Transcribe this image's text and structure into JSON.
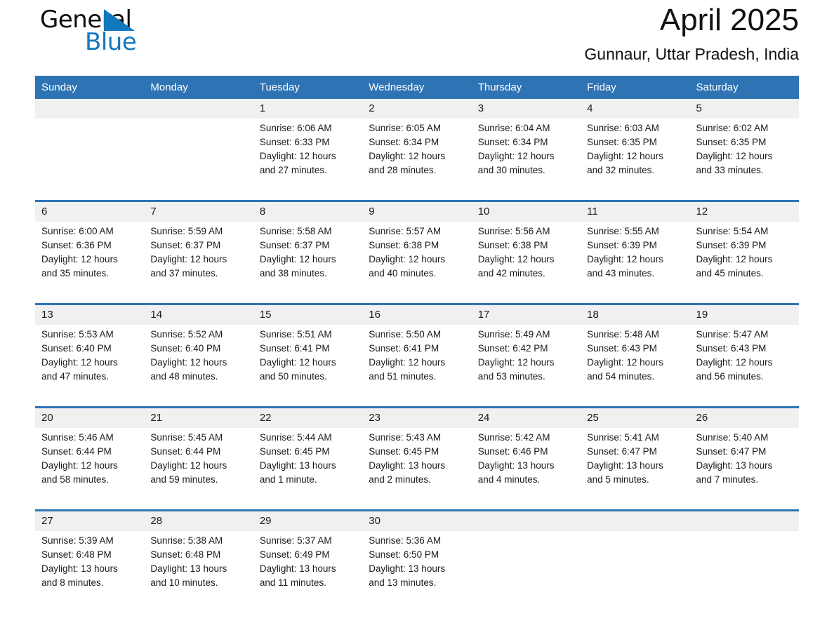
{
  "brand": {
    "name_part1": "General",
    "name_part2": "Blue",
    "accent_color": "#1278be"
  },
  "header": {
    "title": "April 2025",
    "subtitle": "Gunnaur, Uttar Pradesh, India"
  },
  "theme": {
    "header_blue": "#2e74b5",
    "daynum_band": "#f0f0f0",
    "text": "#1a1a1a"
  },
  "weekday_headers": [
    "Sunday",
    "Monday",
    "Tuesday",
    "Wednesday",
    "Thursday",
    "Friday",
    "Saturday"
  ],
  "weeks": [
    {
      "days": [
        {
          "num": "",
          "sunrise": "",
          "sunset": "",
          "daylight_line1": "",
          "daylight_line2": ""
        },
        {
          "num": "",
          "sunrise": "",
          "sunset": "",
          "daylight_line1": "",
          "daylight_line2": ""
        },
        {
          "num": "1",
          "sunrise": "Sunrise: 6:06 AM",
          "sunset": "Sunset: 6:33 PM",
          "daylight_line1": "Daylight: 12 hours",
          "daylight_line2": "and 27 minutes."
        },
        {
          "num": "2",
          "sunrise": "Sunrise: 6:05 AM",
          "sunset": "Sunset: 6:34 PM",
          "daylight_line1": "Daylight: 12 hours",
          "daylight_line2": "and 28 minutes."
        },
        {
          "num": "3",
          "sunrise": "Sunrise: 6:04 AM",
          "sunset": "Sunset: 6:34 PM",
          "daylight_line1": "Daylight: 12 hours",
          "daylight_line2": "and 30 minutes."
        },
        {
          "num": "4",
          "sunrise": "Sunrise: 6:03 AM",
          "sunset": "Sunset: 6:35 PM",
          "daylight_line1": "Daylight: 12 hours",
          "daylight_line2": "and 32 minutes."
        },
        {
          "num": "5",
          "sunrise": "Sunrise: 6:02 AM",
          "sunset": "Sunset: 6:35 PM",
          "daylight_line1": "Daylight: 12 hours",
          "daylight_line2": "and 33 minutes."
        }
      ]
    },
    {
      "days": [
        {
          "num": "6",
          "sunrise": "Sunrise: 6:00 AM",
          "sunset": "Sunset: 6:36 PM",
          "daylight_line1": "Daylight: 12 hours",
          "daylight_line2": "and 35 minutes."
        },
        {
          "num": "7",
          "sunrise": "Sunrise: 5:59 AM",
          "sunset": "Sunset: 6:37 PM",
          "daylight_line1": "Daylight: 12 hours",
          "daylight_line2": "and 37 minutes."
        },
        {
          "num": "8",
          "sunrise": "Sunrise: 5:58 AM",
          "sunset": "Sunset: 6:37 PM",
          "daylight_line1": "Daylight: 12 hours",
          "daylight_line2": "and 38 minutes."
        },
        {
          "num": "9",
          "sunrise": "Sunrise: 5:57 AM",
          "sunset": "Sunset: 6:38 PM",
          "daylight_line1": "Daylight: 12 hours",
          "daylight_line2": "and 40 minutes."
        },
        {
          "num": "10",
          "sunrise": "Sunrise: 5:56 AM",
          "sunset": "Sunset: 6:38 PM",
          "daylight_line1": "Daylight: 12 hours",
          "daylight_line2": "and 42 minutes."
        },
        {
          "num": "11",
          "sunrise": "Sunrise: 5:55 AM",
          "sunset": "Sunset: 6:39 PM",
          "daylight_line1": "Daylight: 12 hours",
          "daylight_line2": "and 43 minutes."
        },
        {
          "num": "12",
          "sunrise": "Sunrise: 5:54 AM",
          "sunset": "Sunset: 6:39 PM",
          "daylight_line1": "Daylight: 12 hours",
          "daylight_line2": "and 45 minutes."
        }
      ]
    },
    {
      "days": [
        {
          "num": "13",
          "sunrise": "Sunrise: 5:53 AM",
          "sunset": "Sunset: 6:40 PM",
          "daylight_line1": "Daylight: 12 hours",
          "daylight_line2": "and 47 minutes."
        },
        {
          "num": "14",
          "sunrise": "Sunrise: 5:52 AM",
          "sunset": "Sunset: 6:40 PM",
          "daylight_line1": "Daylight: 12 hours",
          "daylight_line2": "and 48 minutes."
        },
        {
          "num": "15",
          "sunrise": "Sunrise: 5:51 AM",
          "sunset": "Sunset: 6:41 PM",
          "daylight_line1": "Daylight: 12 hours",
          "daylight_line2": "and 50 minutes."
        },
        {
          "num": "16",
          "sunrise": "Sunrise: 5:50 AM",
          "sunset": "Sunset: 6:41 PM",
          "daylight_line1": "Daylight: 12 hours",
          "daylight_line2": "and 51 minutes."
        },
        {
          "num": "17",
          "sunrise": "Sunrise: 5:49 AM",
          "sunset": "Sunset: 6:42 PM",
          "daylight_line1": "Daylight: 12 hours",
          "daylight_line2": "and 53 minutes."
        },
        {
          "num": "18",
          "sunrise": "Sunrise: 5:48 AM",
          "sunset": "Sunset: 6:43 PM",
          "daylight_line1": "Daylight: 12 hours",
          "daylight_line2": "and 54 minutes."
        },
        {
          "num": "19",
          "sunrise": "Sunrise: 5:47 AM",
          "sunset": "Sunset: 6:43 PM",
          "daylight_line1": "Daylight: 12 hours",
          "daylight_line2": "and 56 minutes."
        }
      ]
    },
    {
      "days": [
        {
          "num": "20",
          "sunrise": "Sunrise: 5:46 AM",
          "sunset": "Sunset: 6:44 PM",
          "daylight_line1": "Daylight: 12 hours",
          "daylight_line2": "and 58 minutes."
        },
        {
          "num": "21",
          "sunrise": "Sunrise: 5:45 AM",
          "sunset": "Sunset: 6:44 PM",
          "daylight_line1": "Daylight: 12 hours",
          "daylight_line2": "and 59 minutes."
        },
        {
          "num": "22",
          "sunrise": "Sunrise: 5:44 AM",
          "sunset": "Sunset: 6:45 PM",
          "daylight_line1": "Daylight: 13 hours",
          "daylight_line2": "and 1 minute."
        },
        {
          "num": "23",
          "sunrise": "Sunrise: 5:43 AM",
          "sunset": "Sunset: 6:45 PM",
          "daylight_line1": "Daylight: 13 hours",
          "daylight_line2": "and 2 minutes."
        },
        {
          "num": "24",
          "sunrise": "Sunrise: 5:42 AM",
          "sunset": "Sunset: 6:46 PM",
          "daylight_line1": "Daylight: 13 hours",
          "daylight_line2": "and 4 minutes."
        },
        {
          "num": "25",
          "sunrise": "Sunrise: 5:41 AM",
          "sunset": "Sunset: 6:47 PM",
          "daylight_line1": "Daylight: 13 hours",
          "daylight_line2": "and 5 minutes."
        },
        {
          "num": "26",
          "sunrise": "Sunrise: 5:40 AM",
          "sunset": "Sunset: 6:47 PM",
          "daylight_line1": "Daylight: 13 hours",
          "daylight_line2": "and 7 minutes."
        }
      ]
    },
    {
      "days": [
        {
          "num": "27",
          "sunrise": "Sunrise: 5:39 AM",
          "sunset": "Sunset: 6:48 PM",
          "daylight_line1": "Daylight: 13 hours",
          "daylight_line2": "and 8 minutes."
        },
        {
          "num": "28",
          "sunrise": "Sunrise: 5:38 AM",
          "sunset": "Sunset: 6:48 PM",
          "daylight_line1": "Daylight: 13 hours",
          "daylight_line2": "and 10 minutes."
        },
        {
          "num": "29",
          "sunrise": "Sunrise: 5:37 AM",
          "sunset": "Sunset: 6:49 PM",
          "daylight_line1": "Daylight: 13 hours",
          "daylight_line2": "and 11 minutes."
        },
        {
          "num": "30",
          "sunrise": "Sunrise: 5:36 AM",
          "sunset": "Sunset: 6:50 PM",
          "daylight_line1": "Daylight: 13 hours",
          "daylight_line2": "and 13 minutes."
        },
        {
          "num": "",
          "sunrise": "",
          "sunset": "",
          "daylight_line1": "",
          "daylight_line2": ""
        },
        {
          "num": "",
          "sunrise": "",
          "sunset": "",
          "daylight_line1": "",
          "daylight_line2": ""
        },
        {
          "num": "",
          "sunrise": "",
          "sunset": "",
          "daylight_line1": "",
          "daylight_line2": ""
        }
      ]
    }
  ]
}
